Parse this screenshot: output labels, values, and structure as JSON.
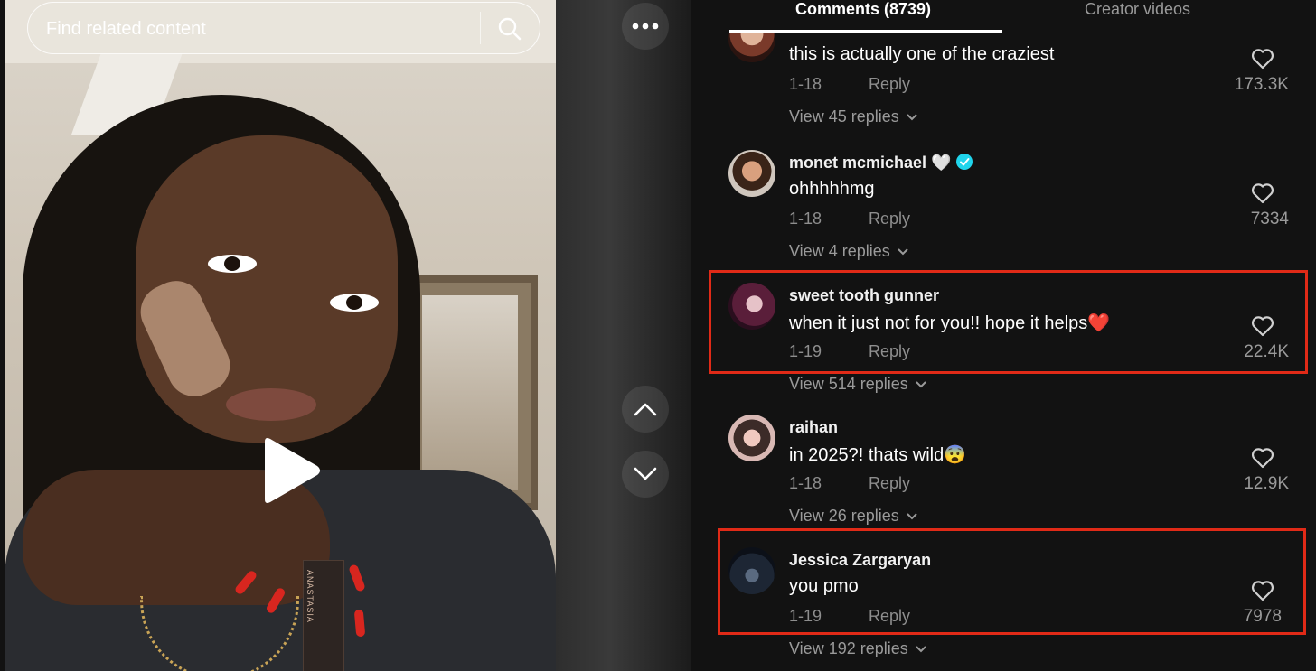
{
  "search": {
    "placeholder": "Find related content"
  },
  "video": {
    "product_box_text": "ANASTASIA"
  },
  "tabs": [
    {
      "label": "Comments (8739)",
      "active": true
    },
    {
      "label": "Creator videos",
      "active": false
    }
  ],
  "comments": [
    {
      "username": "maisie wilder",
      "text": "this is actually one of the craziest",
      "date": "1-18",
      "reply_label": "Reply",
      "likes": "173.3K",
      "view_replies": "View 45 replies",
      "highlighted": false
    },
    {
      "username": "monet mcmichael 🤍",
      "verified": true,
      "text": "ohhhhhmg",
      "date": "1-18",
      "reply_label": "Reply",
      "likes": "7334",
      "view_replies": "View 4 replies",
      "highlighted": false
    },
    {
      "username": "sweet tooth gunner",
      "text": "when it just not for you!! hope it helps❤️",
      "date": "1-19",
      "reply_label": "Reply",
      "likes": "22.4K",
      "view_replies": "View 514 replies",
      "highlighted": true
    },
    {
      "username": "raihan",
      "text": "in 2025?! thats wild😨",
      "date": "1-18",
      "reply_label": "Reply",
      "likes": "12.9K",
      "view_replies": "View 26 replies",
      "highlighted": false
    },
    {
      "username": "Jessica Zargaryan",
      "text": "you pmo",
      "date": "1-19",
      "reply_label": "Reply",
      "likes": "7978",
      "view_replies": "View 192 replies",
      "highlighted": true
    }
  ],
  "colors": {
    "background": "#121212",
    "highlight_border": "#e02a17",
    "verified_badge": "#20d5ec",
    "muted_text": "#8e8e8e"
  },
  "icons": [
    "search-icon",
    "play-icon",
    "more-icon",
    "chevron-up-icon",
    "chevron-down-icon",
    "heart-icon",
    "verified-icon"
  ]
}
